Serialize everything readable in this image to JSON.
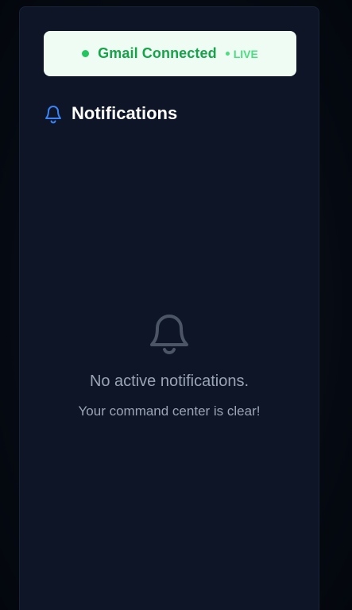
{
  "gmail": {
    "status_label": "Gmail Connected",
    "live_label": "LIVE"
  },
  "notifications": {
    "title": "Notifications",
    "empty_title": "No active notifications.",
    "empty_subtitle": "Your command center is clear!"
  },
  "icons": {
    "header": "bell-icon",
    "empty_state": "bell-icon"
  },
  "colors": {
    "background": "#050a12",
    "panel": "#0d1526",
    "connected_green": "#16a34a",
    "live_green": "#4ade80",
    "bell_blue": "#3b82f6",
    "muted_text": "#9aa4b4"
  }
}
